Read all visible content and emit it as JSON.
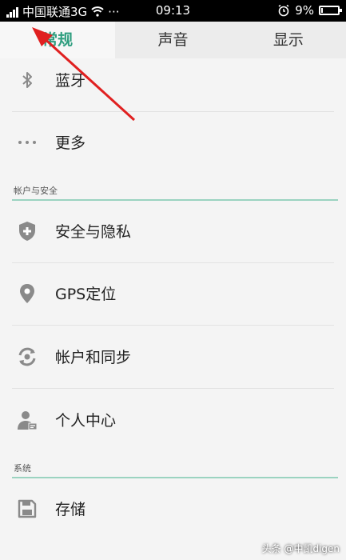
{
  "status_bar": {
    "carrier": "中国联通3G",
    "more": "···",
    "time": "09:13",
    "battery_percent": "9%",
    "battery_level": 0.09
  },
  "tabs": [
    {
      "label": "常规",
      "active": true
    },
    {
      "label": "声音",
      "active": false
    },
    {
      "label": "显示",
      "active": false
    }
  ],
  "items": {
    "bluetooth": "蓝牙",
    "more": "更多",
    "section_account": "帐户与安全",
    "security": "安全与隐私",
    "gps": "GPS定位",
    "sync": "帐户和同步",
    "personal": "个人中心",
    "section_system": "系统",
    "storage": "存储"
  },
  "watermark": "头条 @中凯digen",
  "accent_color": "#2f9e7f",
  "annotation_color": "#e02020"
}
